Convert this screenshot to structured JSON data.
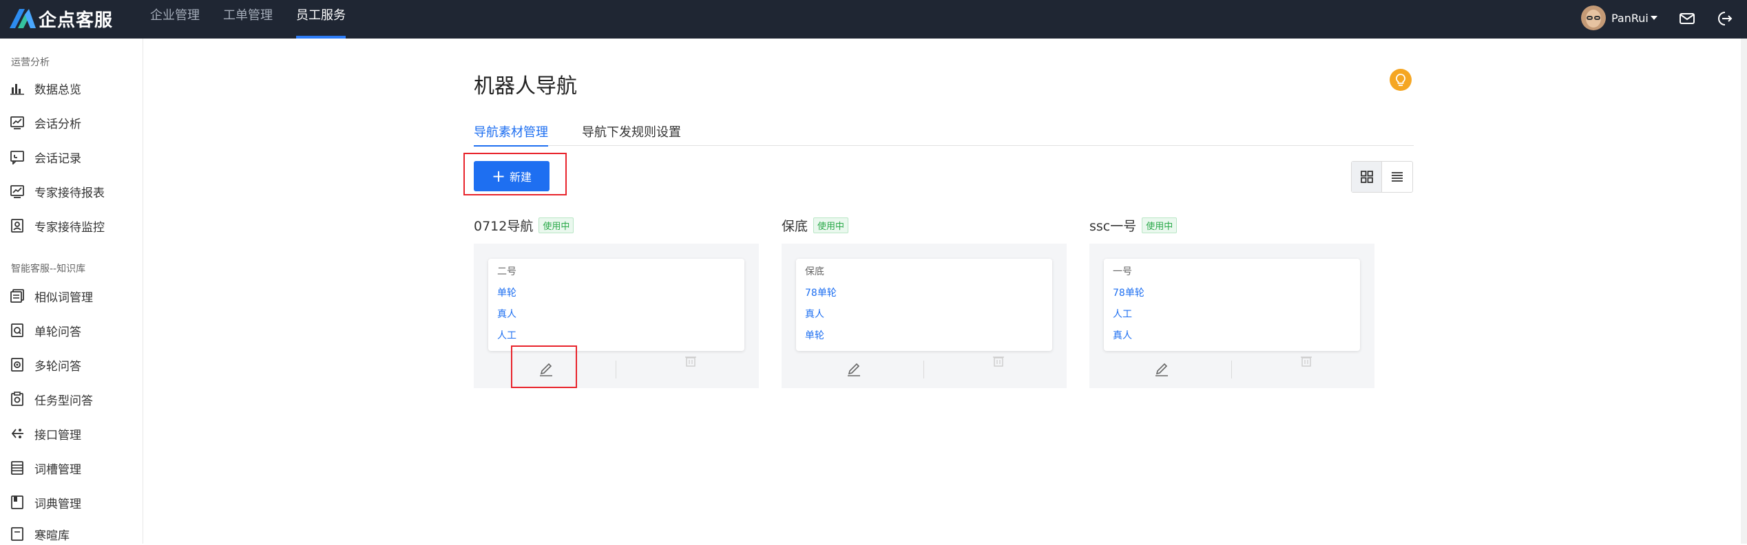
{
  "app": {
    "logo_text": "企点客服"
  },
  "topnav": [
    {
      "label": "企业管理",
      "active": false
    },
    {
      "label": "工单管理",
      "active": false
    },
    {
      "label": "员工服务",
      "active": true
    }
  ],
  "user": {
    "name": "PanRui"
  },
  "sidebar": {
    "groups": [
      {
        "title": "运营分析",
        "items": [
          {
            "label": "数据总览",
            "icon": "bar-chart-icon"
          },
          {
            "label": "会话分析",
            "icon": "trend-chart-icon"
          },
          {
            "label": "会话记录",
            "icon": "chat-record-icon"
          },
          {
            "label": "专家接待报表",
            "icon": "report-icon"
          },
          {
            "label": "专家接待监控",
            "icon": "monitor-icon"
          }
        ]
      },
      {
        "title": "智能客服--知识库",
        "items": [
          {
            "label": "相似词管理",
            "icon": "similar-words-icon"
          },
          {
            "label": "单轮问答",
            "icon": "single-qa-icon"
          },
          {
            "label": "多轮问答",
            "icon": "multi-qa-icon"
          },
          {
            "label": "任务型问答",
            "icon": "task-qa-icon"
          },
          {
            "label": "接口管理",
            "icon": "api-icon"
          },
          {
            "label": "词槽管理",
            "icon": "slot-icon"
          },
          {
            "label": "词典管理",
            "icon": "dictionary-icon"
          },
          {
            "label": "寒暄库",
            "icon": "chitchat-icon"
          }
        ]
      }
    ]
  },
  "main": {
    "title": "机器人导航",
    "tabs": [
      {
        "label": "导航素材管理",
        "active": true
      },
      {
        "label": "导航下发规则设置",
        "active": false
      }
    ],
    "new_button": "新建",
    "cards": [
      {
        "name": "0712导航",
        "status": "使用中",
        "lines": [
          "二号",
          "单轮",
          "真人",
          "人工"
        ]
      },
      {
        "name": "保底",
        "status": "使用中",
        "lines": [
          "保底",
          "78单轮",
          "真人",
          "单轮"
        ]
      },
      {
        "name": "ssc一号",
        "status": "使用中",
        "lines": [
          "一号",
          "78单轮",
          "人工",
          "真人"
        ]
      }
    ]
  },
  "colors": {
    "topbar": "#1f2633",
    "accent": "#1e6ff1",
    "badge_text": "#2aa949",
    "highlight": "#e8232b",
    "bulb": "#f5a623"
  }
}
